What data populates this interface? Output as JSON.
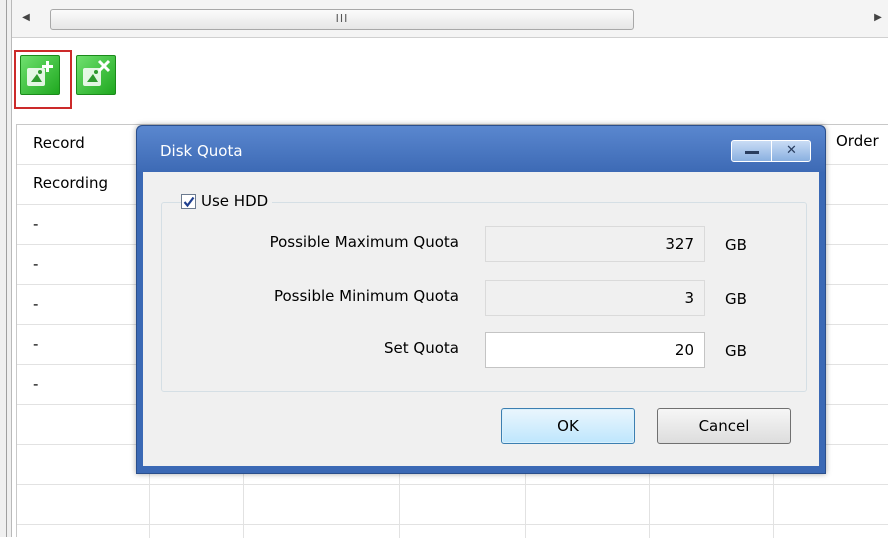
{
  "scrollbar": {
    "grip": "III"
  },
  "toolbar": {
    "add_icon": "add-camera-icon",
    "delete_icon": "remove-camera-icon"
  },
  "table": {
    "headers": [
      "Record",
      "Order"
    ],
    "rows": [
      "Recording",
      "-",
      "-",
      "-",
      "-",
      "-"
    ]
  },
  "dialog": {
    "title": "Disk Quota",
    "use_hdd": {
      "label": "Use HDD",
      "checked": true
    },
    "fields": [
      {
        "label": "Possible Maximum Quota",
        "value": "327",
        "unit": "GB"
      },
      {
        "label": "Possible Minimum Quota",
        "value": "3",
        "unit": "GB"
      },
      {
        "label": "Set Quota",
        "value": "20",
        "unit": "GB"
      }
    ],
    "ok_label": "OK",
    "cancel_label": "Cancel"
  },
  "colors": {
    "titlebar": "#3b69b5",
    "highlight": "#cc2a2a",
    "tool_green": "#33bb33"
  }
}
